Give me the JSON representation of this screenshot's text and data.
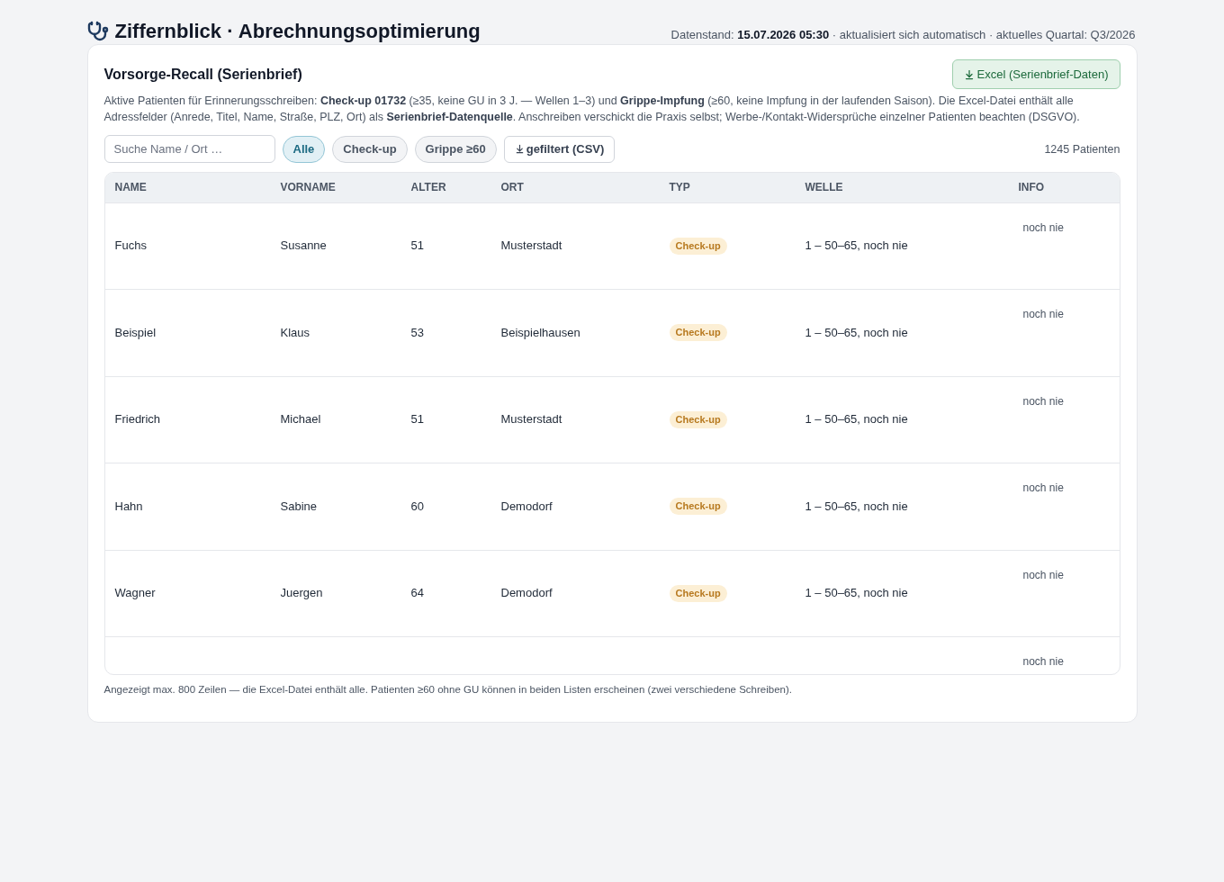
{
  "header": {
    "title": "Ziffernblick · Abrechnungsoptimierung",
    "meta": "Datenstand: **15.07.2026 05:30** · aktualisiert sich automatisch · aktuelles Quartal: Q3/2026"
  },
  "card": {
    "title": "Vorsorge-Recall (Serienbrief)",
    "export_button": "Excel (Serienbrief-Daten)",
    "description": "Aktive Patienten für Erinnerungsschreiben: **Check-up 01732** (≥35, keine GU in 3 J. — Wellen 1–3) und **Grippe-Impfung** (≥60, keine Impfung in der laufenden Saison). Die Excel-Datei enthält alle Adressfelder (Anrede, Titel, Name, Straße, PLZ, Ort) als **Serienbrief-Datenquelle**. Anschreiben verschickt die Praxis selbst; Werbe-/Kontakt-Widersprüche einzelner Patienten beachten (DSGVO).",
    "search": {
      "placeholder": "Suche Name / Ort …"
    },
    "filters": [
      {
        "label": "Alle",
        "selected": true
      },
      {
        "label": "Check-up",
        "selected": false
      },
      {
        "label": "Grippe ≥60",
        "selected": false
      }
    ],
    "csv_button": "gefiltert (CSV)",
    "count": "1245 Patienten",
    "table": {
      "columns": [
        "NAME",
        "VORNAME",
        "ALTER",
        "ORT",
        "TYP",
        "WELLE",
        "INFO"
      ],
      "rows": [
        {
          "name": "Fuchs",
          "vorname": "Susanne",
          "alter": "51",
          "ort": "Musterstadt",
          "typ": "Check-up",
          "welle": "1 – 50–65, noch nie",
          "info": "noch nie"
        },
        {
          "name": "Beispiel",
          "vorname": "Klaus",
          "alter": "53",
          "ort": "Beispielhausen",
          "typ": "Check-up",
          "welle": "1 – 50–65, noch nie",
          "info": "noch nie"
        },
        {
          "name": "Friedrich",
          "vorname": "Michael",
          "alter": "51",
          "ort": "Musterstadt",
          "typ": "Check-up",
          "welle": "1 – 50–65, noch nie",
          "info": "noch nie"
        },
        {
          "name": "Hahn",
          "vorname": "Sabine",
          "alter": "60",
          "ort": "Demodorf",
          "typ": "Check-up",
          "welle": "1 – 50–65, noch nie",
          "info": "noch nie"
        },
        {
          "name": "Wagner",
          "vorname": "Juergen",
          "alter": "64",
          "ort": "Demodorf",
          "typ": "Check-up",
          "welle": "1 – 50–65, noch nie",
          "info": "noch nie"
        },
        {
          "info": "noch nie"
        }
      ]
    },
    "footnote": "Angezeigt max. 800 Zeilen — die Excel-Datei enthält alle. Patienten ≥60 ohne GU können in beiden Listen erscheinen (zwei verschiedene Schreiben)."
  }
}
